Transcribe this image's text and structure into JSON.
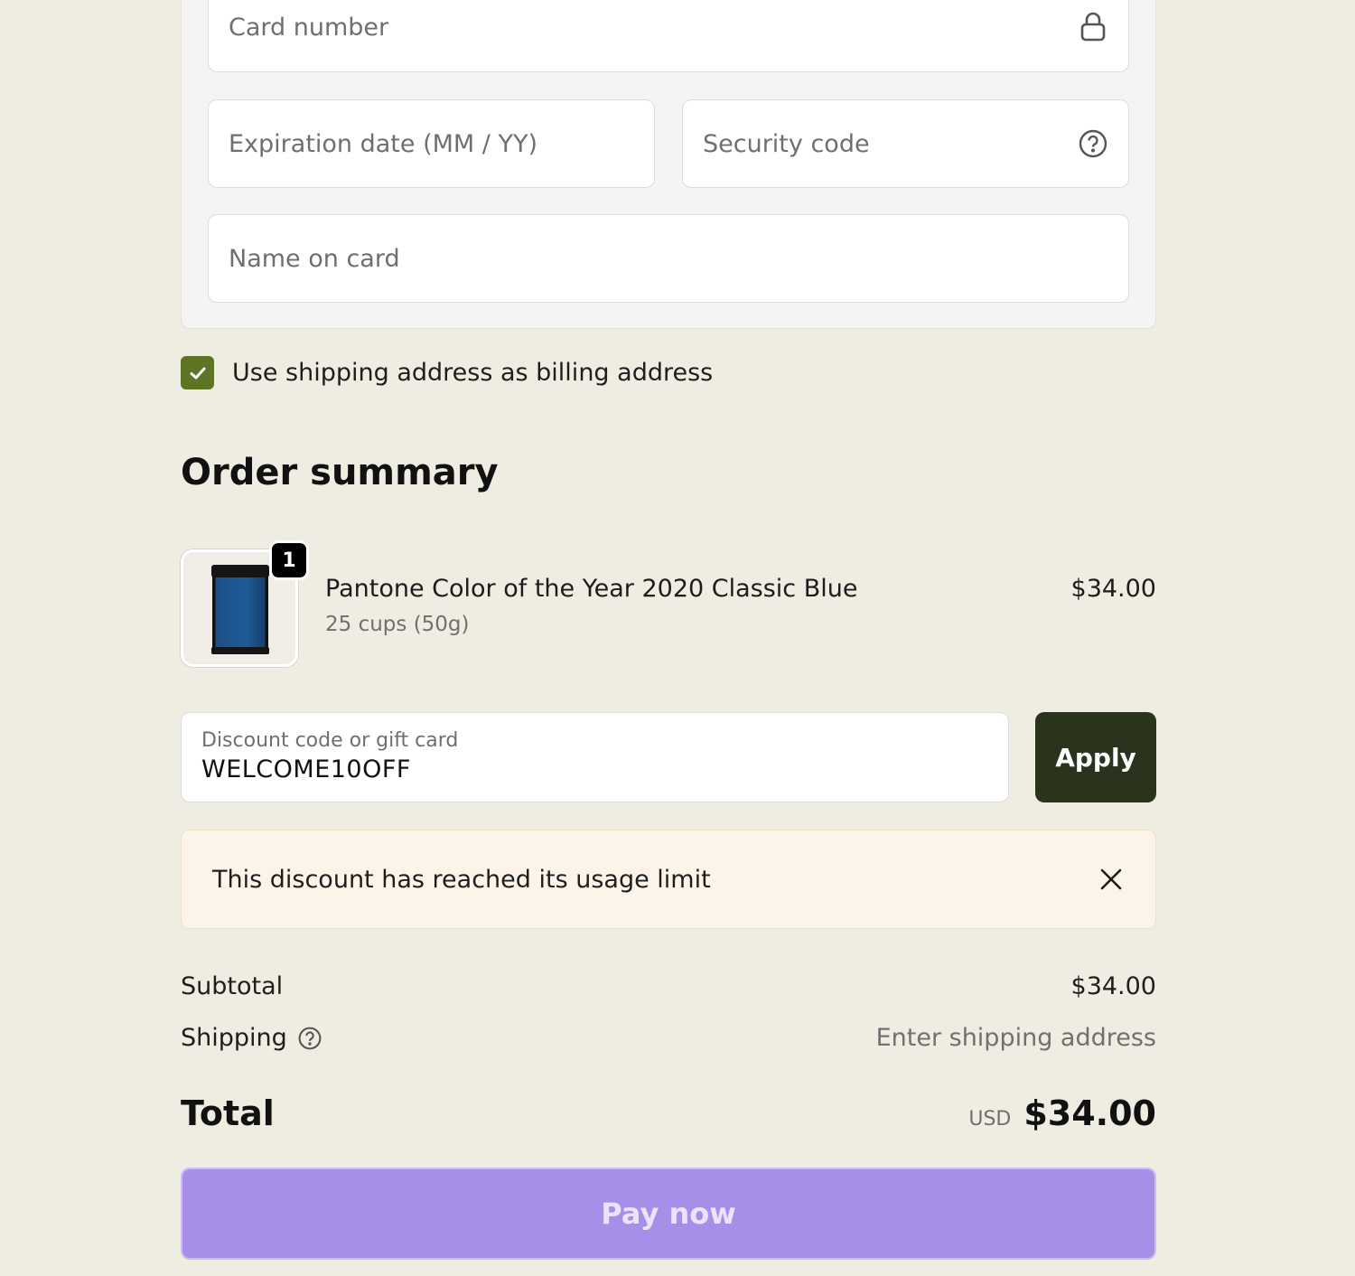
{
  "payment": {
    "card_number_placeholder": "Card number",
    "expiration_placeholder": "Expiration date (MM / YY)",
    "security_code_placeholder": "Security code",
    "name_placeholder": "Name on card",
    "billing_checkbox_label": "Use shipping address as billing address",
    "billing_checked": true
  },
  "summary": {
    "title": "Order summary",
    "product": {
      "quantity": "1",
      "name": "Pantone Color of the Year 2020 Classic Blue",
      "variant": "25 cups (50g)",
      "price": "$34.00"
    },
    "discount": {
      "label": "Discount code or gift card",
      "value": "WELCOME10OFF",
      "apply_label": "Apply"
    },
    "alert": {
      "message": "This discount has reached its usage limit"
    },
    "subtotal_label": "Subtotal",
    "subtotal_value": "$34.00",
    "shipping_label": "Shipping",
    "shipping_value": "Enter shipping address",
    "total_label": "Total",
    "total_currency": "USD",
    "total_value": "$34.00",
    "pay_label": "Pay now"
  },
  "colors": {
    "background": "#efede1",
    "checkbox": "#5d7425",
    "apply_button": "#2a331c",
    "pay_button": "#a78ee8",
    "alert_background": "#fdf4e9"
  },
  "icons": [
    "lock-icon",
    "help-circle-icon",
    "checkmark-icon",
    "close-icon"
  ]
}
